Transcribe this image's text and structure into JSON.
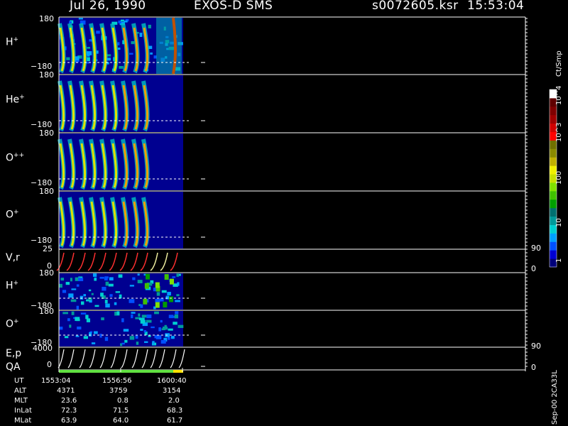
{
  "header": {
    "date": "Jul 26, 1990",
    "instrument": "EXOS-D SMS",
    "file": "s0072605.ksr",
    "time": "15:53:04"
  },
  "colorbar": {
    "title": "Ct/Smp",
    "ticks": [
      "1",
      "10",
      "100",
      "10^3",
      "10^4"
    ],
    "colors": [
      "#00007a",
      "#0000d4",
      "#0050ff",
      "#00a0ff",
      "#00d0d0",
      "#009a9a",
      "#007070",
      "#00a000",
      "#40c000",
      "#80e000",
      "#c8e000",
      "#f0f000",
      "#c0b000",
      "#8a8a00",
      "#707000",
      "#ff0000",
      "#d00000",
      "#a00000",
      "#800000",
      "#600000",
      "#ffffff"
    ]
  },
  "panels": [
    {
      "label": "H",
      "sup": "+",
      "ymax": "180",
      "ymin": "−180"
    },
    {
      "label": "He",
      "sup": "+",
      "ymax": "180",
      "ymin": "−180"
    },
    {
      "label": "O",
      "sup": "++",
      "ymax": "180",
      "ymin": "−180"
    },
    {
      "label": "O",
      "sup": "+",
      "ymax": "180",
      "ymin": "−180"
    },
    {
      "label": "V,r",
      "sup": "",
      "ymax": "25",
      "ymin": "0",
      "rmax": "90",
      "rmin": "0"
    },
    {
      "label": "H",
      "sup": "+",
      "ymax": "180",
      "ymin": "−180"
    },
    {
      "label": "O",
      "sup": "+",
      "ymax": "180",
      "ymin": "−180"
    },
    {
      "label": "E,p",
      "sup": "",
      "ymax": "4000",
      "ymin": "0",
      "rmax": "90",
      "rmin": "0"
    }
  ],
  "qa_label": "QA",
  "footer": {
    "rows": [
      {
        "name": "UT",
        "values": [
          "1553:04",
          "1556:56",
          "1600:40"
        ]
      },
      {
        "name": "ALT",
        "values": [
          "4371",
          "3759",
          "3154"
        ]
      },
      {
        "name": "MLT",
        "values": [
          "23.6",
          "0.8",
          "2.0"
        ]
      },
      {
        "name": "InLat",
        "values": [
          "72.3",
          "71.5",
          "68.3"
        ]
      },
      {
        "name": "MLat",
        "values": [
          "63.9",
          "64.0",
          "61.7"
        ]
      }
    ]
  },
  "side_note": "Sep-00 2CA33L",
  "chart_data": {
    "type": "heatmap",
    "title": "Jul 26, 1990   EXOS-D SMS",
    "x_tick_labels": [
      "1553:04",
      "1556:56",
      "1600:40"
    ],
    "panels": [
      {
        "name": "H+",
        "ylim": [
          -180,
          180
        ]
      },
      {
        "name": "He+",
        "ylim": [
          -180,
          180
        ]
      },
      {
        "name": "O++",
        "ylim": [
          -180,
          180
        ]
      },
      {
        "name": "O+",
        "ylim": [
          -180,
          180
        ]
      },
      {
        "name": "V,r",
        "ylim": [
          0,
          25
        ],
        "y2lim": [
          0,
          90
        ]
      },
      {
        "name": "H+",
        "ylim": [
          -180,
          180
        ]
      },
      {
        "name": "O+",
        "ylim": [
          -180,
          180
        ]
      },
      {
        "name": "E,p",
        "ylim": [
          0,
          4000
        ],
        "y2lim": [
          0,
          90
        ]
      }
    ],
    "colorbar": {
      "label": "Ct/Smp",
      "scale": "log",
      "range": [
        1,
        10000
      ]
    }
  }
}
